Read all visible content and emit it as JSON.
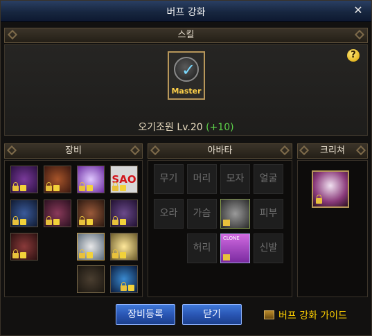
{
  "window": {
    "title": "버프 강화",
    "close": "✕"
  },
  "skill": {
    "header": "스킬",
    "help": "?",
    "icon_badge": "Master",
    "name": "오기조원 Lv.20",
    "bonus": "(+10)"
  },
  "equipment": {
    "header": "장비"
  },
  "avatar": {
    "header": "아바타",
    "slots": [
      "무기",
      "머리",
      "모자",
      "얼굴",
      "오라",
      "가슴",
      "피부",
      "허리",
      "신발"
    ]
  },
  "creature": {
    "header": "크리쳐"
  },
  "buttons": {
    "register": "장비등록",
    "close": "닫기"
  },
  "guide": {
    "label": "버프 강화 가이드"
  },
  "colors": {
    "accent_gold": "#b8975a",
    "bonus_green": "#5dd14a",
    "guide_yellow": "#ffd000",
    "button_blue": "#2a56b4"
  }
}
